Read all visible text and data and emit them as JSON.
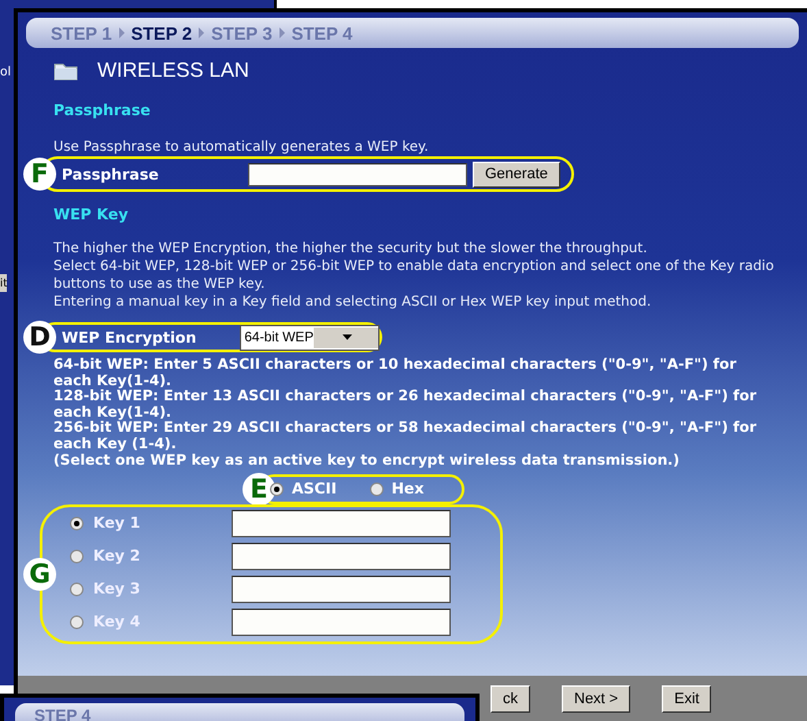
{
  "background_window": {
    "fragments": [
      "ol",
      "it"
    ]
  },
  "steps": [
    {
      "label": "STEP 1",
      "selected": false
    },
    {
      "label": "STEP 2",
      "selected": true
    },
    {
      "label": "STEP 3",
      "selected": false
    },
    {
      "label": "STEP 4",
      "selected": false
    }
  ],
  "title": "WIRELESS LAN",
  "passphrase_section": {
    "heading": "Passphrase",
    "description": "Use Passphrase to automatically generates a WEP key.",
    "callout": "F",
    "label": "Passphrase",
    "button": "Generate"
  },
  "wep_key_section": {
    "heading": "WEP Key",
    "description": [
      "The higher the WEP Encryption, the higher the security but the slower the throughput.",
      "Select 64-bit WEP, 128-bit WEP or 256-bit WEP to enable data encryption and select one of the Key radio buttons to use as the WEP key.",
      "Entering a manual key in a Key field and selecting ASCII or Hex WEP key input method."
    ],
    "encryption": {
      "callout": "D",
      "label": "WEP Encryption",
      "value": "64-bit WEP"
    },
    "notes": [
      "64-bit WEP: Enter 5 ASCII characters or 10 hexadecimal characters (\"0-9\", \"A-F\") for each Key(1-4).",
      "128-bit WEP: Enter 13 ASCII characters or 26 hexadecimal characters (\"0-9\", \"A-F\") for each Key(1-4).",
      "256-bit WEP: Enter 29 ASCII characters or 58 hexadecimal characters (\"0-9\", \"A-F\") for each Key (1-4).",
      "(Select one WEP key as an active key to encrypt wireless data transmission.)"
    ],
    "input_method": {
      "callout": "E",
      "options": [
        {
          "label": "ASCII",
          "selected": true
        },
        {
          "label": "Hex",
          "selected": false
        }
      ]
    },
    "keys": {
      "callout": "G",
      "items": [
        {
          "label": "Key 1",
          "selected": true
        },
        {
          "label": "Key 2",
          "selected": false
        },
        {
          "label": "Key 3",
          "selected": false
        },
        {
          "label": "Key 4",
          "selected": false
        }
      ]
    }
  },
  "buttons": [
    "ck",
    "Next >",
    "Exit"
  ],
  "front_window": {
    "step": "STEP 4"
  }
}
